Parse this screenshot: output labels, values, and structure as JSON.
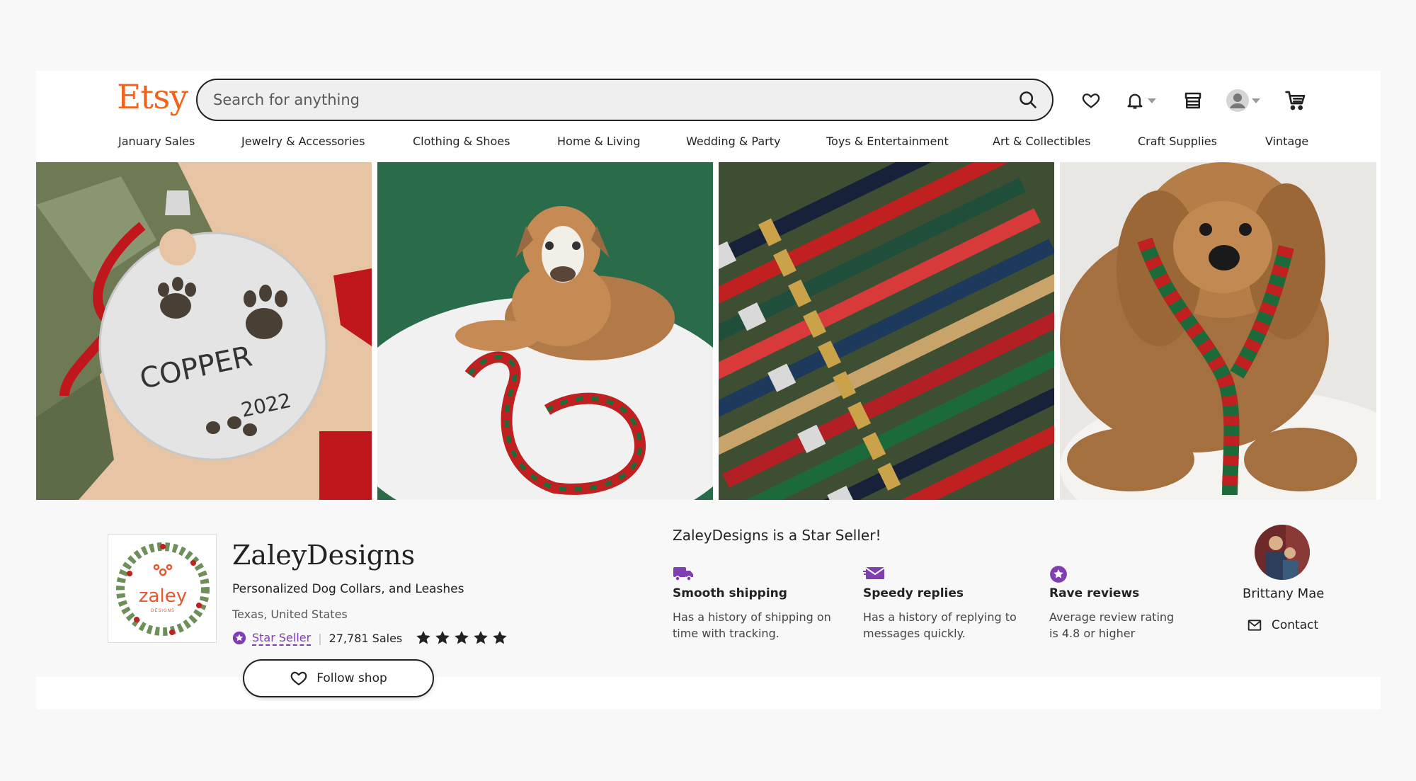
{
  "brand": {
    "logo_text": "Etsy",
    "accent": "#f1641e"
  },
  "search": {
    "placeholder": "Search for anything",
    "value": ""
  },
  "header_icons": [
    "heart-icon",
    "bell-icon",
    "shop-icon",
    "avatar",
    "cart-icon"
  ],
  "nav": {
    "items": [
      {
        "label": "January Sales"
      },
      {
        "label": "Jewelry & Accessories"
      },
      {
        "label": "Clothing & Shoes"
      },
      {
        "label": "Home & Living"
      },
      {
        "label": "Wedding & Party"
      },
      {
        "label": "Toys & Entertainment"
      },
      {
        "label": "Art & Collectibles"
      },
      {
        "label": "Craft Supplies"
      },
      {
        "label": "Vintage"
      }
    ]
  },
  "hero": {
    "ornament_name": "COPPER",
    "ornament_year": "2022"
  },
  "shop": {
    "logo_text": "zaley",
    "logo_subtext": "DESIGNS",
    "name": "ZaleyDesigns",
    "tagline": "Personalized Dog Collars, and Leashes",
    "location": "Texas, United States",
    "star_seller_label": "Star Seller",
    "sales": "27,781 Sales",
    "rating_stars": 5,
    "follow_label": "Follow shop",
    "star_color": "#7f3fb0"
  },
  "star_seller": {
    "title": "ZaleyDesigns is a Star Seller!",
    "features": [
      {
        "icon": "truck-icon",
        "title": "Smooth shipping",
        "desc_1": "Has a history of shipping on",
        "desc_2": "time with tracking."
      },
      {
        "icon": "envelope-icon",
        "title": "Speedy replies",
        "desc_1": "Has a history of replying to",
        "desc_2": "messages quickly."
      },
      {
        "icon": "star-badge-icon",
        "title": "Rave reviews",
        "desc_1": "Average review rating",
        "desc_2": "is 4.8 or higher"
      }
    ]
  },
  "owner": {
    "name": "Brittany Mae",
    "contact_label": "Contact"
  }
}
